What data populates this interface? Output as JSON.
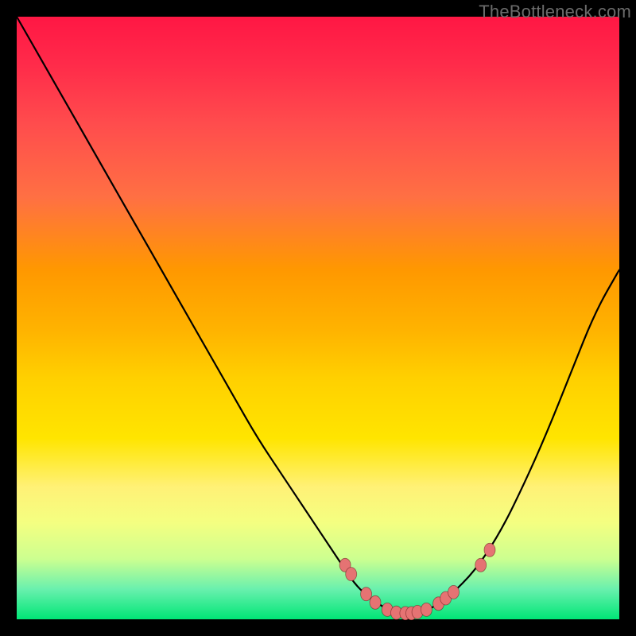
{
  "watermark": "TheBottleneck.com",
  "colors": {
    "top": "#ff1744",
    "mid": "#ffd000",
    "bottom": "#00e676",
    "curve": "#000000",
    "marker": "#e57373",
    "frame": "#000000"
  },
  "chart_data": {
    "type": "line",
    "title": "",
    "xlabel": "",
    "ylabel": "",
    "xlim": [
      0,
      100
    ],
    "ylim": [
      0,
      100
    ],
    "series": [
      {
        "name": "bottleneck-curve",
        "x": [
          0,
          4,
          8,
          12,
          16,
          20,
          24,
          28,
          32,
          36,
          40,
          44,
          48,
          52,
          54,
          56,
          58,
          60,
          62,
          64,
          66,
          68,
          70,
          72,
          76,
          80,
          84,
          88,
          92,
          96,
          100
        ],
        "y": [
          100,
          93,
          86,
          79,
          72,
          65,
          58,
          51,
          44,
          37,
          30,
          24,
          18,
          12,
          9,
          6,
          4,
          2.5,
          1.5,
          1,
          1,
          1.5,
          2.5,
          4,
          8,
          14,
          22,
          31,
          41,
          51,
          58
        ]
      }
    ],
    "markers": {
      "name": "highlighted-points",
      "points": [
        {
          "x": 54.5,
          "y": 9
        },
        {
          "x": 55.5,
          "y": 7.5
        },
        {
          "x": 58,
          "y": 4.2
        },
        {
          "x": 59.5,
          "y": 2.8
        },
        {
          "x": 61.5,
          "y": 1.6
        },
        {
          "x": 63,
          "y": 1.1
        },
        {
          "x": 64.5,
          "y": 1
        },
        {
          "x": 65.5,
          "y": 1
        },
        {
          "x": 66.5,
          "y": 1.2
        },
        {
          "x": 68,
          "y": 1.6
        },
        {
          "x": 70,
          "y": 2.6
        },
        {
          "x": 71.2,
          "y": 3.5
        },
        {
          "x": 72.5,
          "y": 4.5
        },
        {
          "x": 77,
          "y": 9
        },
        {
          "x": 78.5,
          "y": 11.5
        }
      ]
    },
    "grid": false,
    "legend": false
  }
}
